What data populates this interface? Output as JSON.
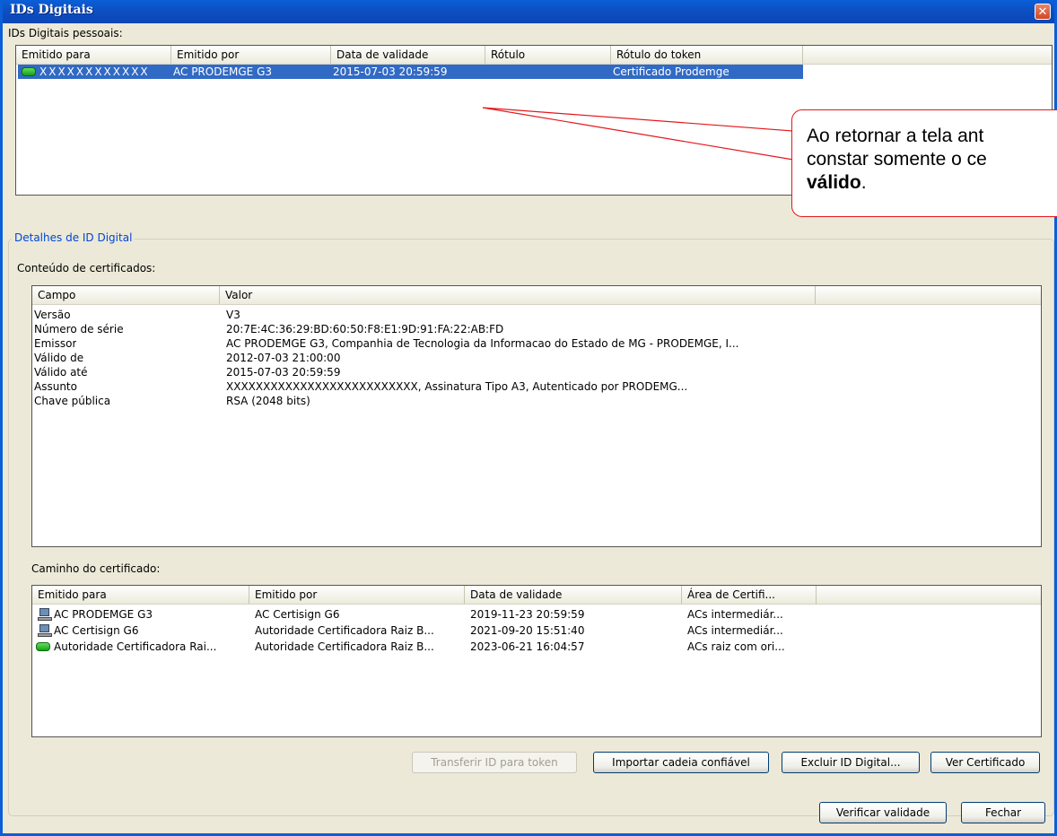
{
  "window": {
    "title": "IDs Digitais",
    "close_glyph": "✕"
  },
  "personal_ids": {
    "label": "IDs Digitais pessoais:",
    "columns": [
      "Emitido para",
      "Emitido por",
      "Data de validade",
      "Rótulo",
      "Rótulo do token"
    ],
    "rows": [
      {
        "emitido_para": "XXXXXXXXXXXX",
        "emitido_por": "AC PRODEMGE G3",
        "validade": "2015-07-03 20:59:59",
        "rotulo": "",
        "rotulo_token": "Certificado Prodemge",
        "icon": "token-icon"
      }
    ]
  },
  "details": {
    "group_title": "Detalhes de ID Digital",
    "content_label": "Conteúdo de certificados:",
    "columns": [
      "Campo",
      "Valor"
    ],
    "rows": [
      {
        "campo": "Versão",
        "valor": "V3"
      },
      {
        "campo": "Número de série",
        "valor": "20:7E:4C:36:29:BD:60:50:F8:E1:9D:91:FA:22:AB:FD"
      },
      {
        "campo": "Emissor",
        "valor": "AC PRODEMGE G3, Companhia de Tecnologia da Informacao do Estado de MG - PRODEMGE, I..."
      },
      {
        "campo": "Válido de",
        "valor": "2012-07-03 21:00:00"
      },
      {
        "campo": "Válido até",
        "valor": "2015-07-03 20:59:59"
      },
      {
        "campo": "Assunto",
        "valor": "XXXXXXXXXXXXXXXXXXXXXXXXXX, Assinatura Tipo A3, Autenticado por PRODEMG..."
      },
      {
        "campo": "Chave pública",
        "valor": "RSA (2048 bits)"
      }
    ],
    "path_label": "Caminho do certificado:",
    "path_columns": [
      "Emitido para",
      "Emitido por",
      "Data de validade",
      "Área de Certifi..."
    ],
    "path_rows": [
      {
        "emitido_para": "AC PRODEMGE G3",
        "emitido_por": "AC Certisign G6",
        "validade": "2019-11-23 20:59:59",
        "area": "ACs intermediár...",
        "icon": "computer-icon"
      },
      {
        "emitido_para": "AC Certisign G6",
        "emitido_por": "Autoridade Certificadora Raiz B...",
        "validade": "2021-09-20 15:51:40",
        "area": "ACs intermediár...",
        "icon": "computer-icon"
      },
      {
        "emitido_para": "Autoridade Certificadora Rai...",
        "emitido_por": "Autoridade Certificadora Raiz B...",
        "validade": "2023-06-21 16:04:57",
        "area": "ACs raiz com ori...",
        "icon": "token-icon"
      }
    ]
  },
  "buttons": {
    "transferir": "Transferir ID para token",
    "importar": "Importar cadeia confiável",
    "excluir": "Excluir ID Digital...",
    "ver": "Ver Certificado",
    "verificar": "Verificar validade",
    "fechar": "Fechar"
  },
  "callout": {
    "line1": "Ao retornar a tela ant",
    "line2": "constar somente o ce",
    "line3_bold": "válido",
    "line3_rest": "."
  },
  "colors": {
    "selection": "#316ac5",
    "title_bar": "#0a5fd8",
    "callout_border": "#e4181c",
    "group_title": "#0046d5"
  }
}
